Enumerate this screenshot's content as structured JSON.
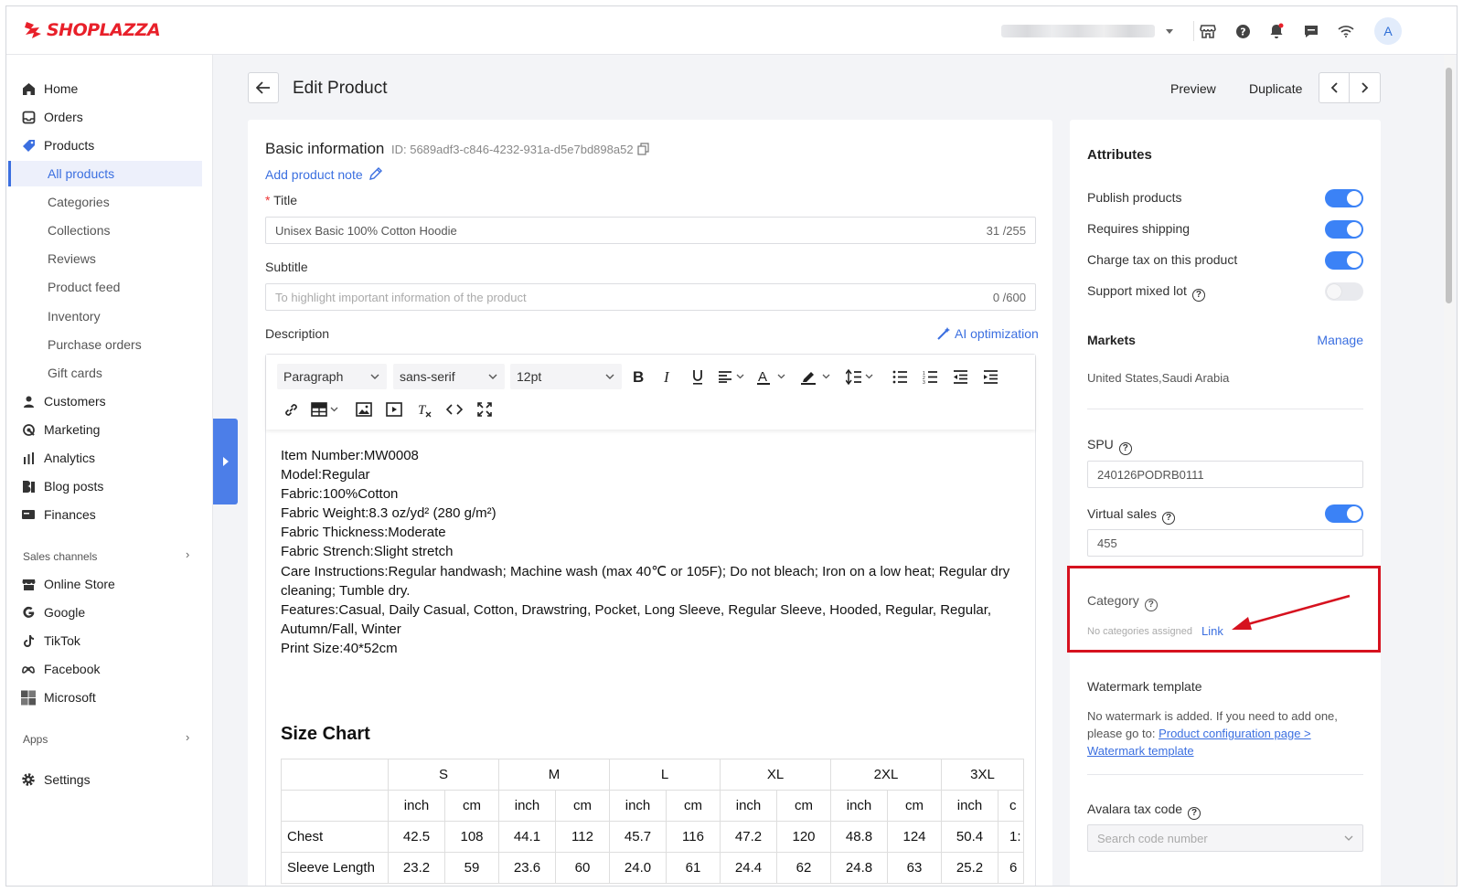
{
  "brand": {
    "name": "SHOPLAZZA",
    "accent": "#e8202a"
  },
  "topbar": {
    "avatar_initial": "A",
    "icons": [
      "store-icon",
      "help-icon",
      "bell-icon",
      "message-icon",
      "wifi-icon"
    ]
  },
  "sidebar": {
    "items": [
      {
        "label": "Home",
        "icon": "home-icon"
      },
      {
        "label": "Orders",
        "icon": "orders-icon"
      },
      {
        "label": "Products",
        "icon": "products-icon"
      },
      {
        "label": "Customers",
        "icon": "customers-icon"
      },
      {
        "label": "Marketing",
        "icon": "marketing-icon"
      },
      {
        "label": "Analytics",
        "icon": "analytics-icon"
      },
      {
        "label": "Blog posts",
        "icon": "blog-icon"
      },
      {
        "label": "Finances",
        "icon": "finances-icon"
      }
    ],
    "product_subitems": [
      "All products",
      "Categories",
      "Collections",
      "Reviews",
      "Product feed",
      "Inventory",
      "Purchase orders",
      "Gift cards"
    ],
    "sales_channels_label": "Sales channels",
    "channels": [
      {
        "label": "Online Store",
        "icon": "store-icon"
      },
      {
        "label": "Google",
        "icon": "google-icon"
      },
      {
        "label": "TikTok",
        "icon": "tiktok-icon"
      },
      {
        "label": "Facebook",
        "icon": "meta-icon"
      },
      {
        "label": "Microsoft",
        "icon": "microsoft-icon"
      }
    ],
    "apps_label": "Apps",
    "settings_label": "Settings"
  },
  "header": {
    "title": "Edit Product",
    "preview": "Preview",
    "duplicate": "Duplicate"
  },
  "basic": {
    "section_title": "Basic information",
    "id_text": "ID: 5689adf3-c846-4232-931a-d5e7bd898a52",
    "add_note": "Add product note",
    "title_label": "Title",
    "title_value": "Unisex Basic 100% Cotton Hoodie",
    "title_count": "31 /255",
    "subtitle_label": "Subtitle",
    "subtitle_placeholder": "To highlight important information of the product",
    "subtitle_count": "0 /600",
    "description_label": "Description",
    "ai_label": "AI optimization"
  },
  "toolbar": {
    "paragraph": "Paragraph",
    "font": "sans-serif",
    "size": "12pt"
  },
  "description_lines": [
    "Item Number:MW0008",
    "Model:Regular",
    "Fabric:100%Cotton",
    "Fabric Weight:8.3 oz/yd² (280 g/m²)",
    "Fabric Thickness:Moderate",
    "Fabric Strench:Slight stretch",
    "Care Instructions:Regular handwash; Machine wash (max 40℃ or 105F); Do not bleach; Iron on a low heat; Regular dry",
    "cleaning; Tumble dry.",
    "Features:Casual, Daily Casual, Cotton, Drawstring, Pocket, Long Sleeve, Regular Sleeve, Hooded, Regular, Regular,",
    "Autumn/Fall, Winter",
    "Print Size:40*52cm"
  ],
  "size_chart": {
    "title": "Size Chart",
    "sizes": [
      "S",
      "M",
      "L",
      "XL",
      "2XL",
      "3XL"
    ],
    "units": [
      "inch",
      "cm",
      "inch",
      "cm",
      "inch",
      "cm",
      "inch",
      "cm",
      "inch",
      "cm",
      "inch",
      "c"
    ],
    "rows": [
      {
        "label": "Chest",
        "values": [
          "42.5",
          "108",
          "44.1",
          "112",
          "45.7",
          "116",
          "47.2",
          "120",
          "48.8",
          "124",
          "50.4",
          "1:"
        ]
      },
      {
        "label": "Sleeve Length",
        "values": [
          "23.2",
          "59",
          "23.6",
          "60",
          "24.0",
          "61",
          "24.4",
          "62",
          "24.8",
          "63",
          "25.2",
          "6"
        ]
      }
    ]
  },
  "attributes": {
    "title": "Attributes",
    "toggles": [
      {
        "label": "Publish products",
        "on": true
      },
      {
        "label": "Requires shipping",
        "on": true
      },
      {
        "label": "Charge tax on this product",
        "on": true
      },
      {
        "label": "Support mixed lot",
        "on": false
      }
    ],
    "markets_label": "Markets",
    "manage": "Manage",
    "markets_value": "United States,Saudi Arabia",
    "spu_label": "SPU",
    "spu_value": "240126PODRB0111",
    "virtual_sales_label": "Virtual sales",
    "virtual_sales_on": true,
    "virtual_sales_value": "455",
    "category_label": "Category",
    "category_empty": "No categories assigned",
    "category_link": "Link",
    "watermark_label": "Watermark template",
    "watermark_text_1": "No watermark is added. If you need to add one,",
    "watermark_text_2": "please go to: ",
    "watermark_link_1": "Product configuration page >",
    "watermark_link_2": "Watermark template",
    "avalara_label": "Avalara tax code",
    "avalara_placeholder": "Search code number"
  }
}
